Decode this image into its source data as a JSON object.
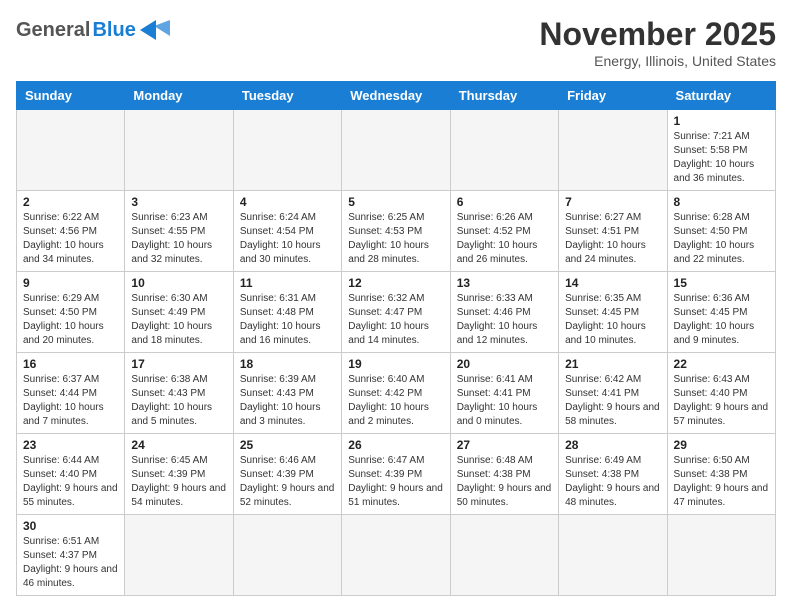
{
  "header": {
    "logo_general": "General",
    "logo_blue": "Blue",
    "month_title": "November 2025",
    "subtitle": "Energy, Illinois, United States"
  },
  "calendar": {
    "days_of_week": [
      "Sunday",
      "Monday",
      "Tuesday",
      "Wednesday",
      "Thursday",
      "Friday",
      "Saturday"
    ],
    "weeks": [
      [
        {
          "day": "",
          "info": ""
        },
        {
          "day": "",
          "info": ""
        },
        {
          "day": "",
          "info": ""
        },
        {
          "day": "",
          "info": ""
        },
        {
          "day": "",
          "info": ""
        },
        {
          "day": "",
          "info": ""
        },
        {
          "day": "1",
          "info": "Sunrise: 7:21 AM\nSunset: 5:58 PM\nDaylight: 10 hours and 36 minutes."
        }
      ],
      [
        {
          "day": "2",
          "info": "Sunrise: 6:22 AM\nSunset: 4:56 PM\nDaylight: 10 hours and 34 minutes."
        },
        {
          "day": "3",
          "info": "Sunrise: 6:23 AM\nSunset: 4:55 PM\nDaylight: 10 hours and 32 minutes."
        },
        {
          "day": "4",
          "info": "Sunrise: 6:24 AM\nSunset: 4:54 PM\nDaylight: 10 hours and 30 minutes."
        },
        {
          "day": "5",
          "info": "Sunrise: 6:25 AM\nSunset: 4:53 PM\nDaylight: 10 hours and 28 minutes."
        },
        {
          "day": "6",
          "info": "Sunrise: 6:26 AM\nSunset: 4:52 PM\nDaylight: 10 hours and 26 minutes."
        },
        {
          "day": "7",
          "info": "Sunrise: 6:27 AM\nSunset: 4:51 PM\nDaylight: 10 hours and 24 minutes."
        },
        {
          "day": "8",
          "info": "Sunrise: 6:28 AM\nSunset: 4:50 PM\nDaylight: 10 hours and 22 minutes."
        }
      ],
      [
        {
          "day": "9",
          "info": "Sunrise: 6:29 AM\nSunset: 4:50 PM\nDaylight: 10 hours and 20 minutes."
        },
        {
          "day": "10",
          "info": "Sunrise: 6:30 AM\nSunset: 4:49 PM\nDaylight: 10 hours and 18 minutes."
        },
        {
          "day": "11",
          "info": "Sunrise: 6:31 AM\nSunset: 4:48 PM\nDaylight: 10 hours and 16 minutes."
        },
        {
          "day": "12",
          "info": "Sunrise: 6:32 AM\nSunset: 4:47 PM\nDaylight: 10 hours and 14 minutes."
        },
        {
          "day": "13",
          "info": "Sunrise: 6:33 AM\nSunset: 4:46 PM\nDaylight: 10 hours and 12 minutes."
        },
        {
          "day": "14",
          "info": "Sunrise: 6:35 AM\nSunset: 4:45 PM\nDaylight: 10 hours and 10 minutes."
        },
        {
          "day": "15",
          "info": "Sunrise: 6:36 AM\nSunset: 4:45 PM\nDaylight: 10 hours and 9 minutes."
        }
      ],
      [
        {
          "day": "16",
          "info": "Sunrise: 6:37 AM\nSunset: 4:44 PM\nDaylight: 10 hours and 7 minutes."
        },
        {
          "day": "17",
          "info": "Sunrise: 6:38 AM\nSunset: 4:43 PM\nDaylight: 10 hours and 5 minutes."
        },
        {
          "day": "18",
          "info": "Sunrise: 6:39 AM\nSunset: 4:43 PM\nDaylight: 10 hours and 3 minutes."
        },
        {
          "day": "19",
          "info": "Sunrise: 6:40 AM\nSunset: 4:42 PM\nDaylight: 10 hours and 2 minutes."
        },
        {
          "day": "20",
          "info": "Sunrise: 6:41 AM\nSunset: 4:41 PM\nDaylight: 10 hours and 0 minutes."
        },
        {
          "day": "21",
          "info": "Sunrise: 6:42 AM\nSunset: 4:41 PM\nDaylight: 9 hours and 58 minutes."
        },
        {
          "day": "22",
          "info": "Sunrise: 6:43 AM\nSunset: 4:40 PM\nDaylight: 9 hours and 57 minutes."
        }
      ],
      [
        {
          "day": "23",
          "info": "Sunrise: 6:44 AM\nSunset: 4:40 PM\nDaylight: 9 hours and 55 minutes."
        },
        {
          "day": "24",
          "info": "Sunrise: 6:45 AM\nSunset: 4:39 PM\nDaylight: 9 hours and 54 minutes."
        },
        {
          "day": "25",
          "info": "Sunrise: 6:46 AM\nSunset: 4:39 PM\nDaylight: 9 hours and 52 minutes."
        },
        {
          "day": "26",
          "info": "Sunrise: 6:47 AM\nSunset: 4:39 PM\nDaylight: 9 hours and 51 minutes."
        },
        {
          "day": "27",
          "info": "Sunrise: 6:48 AM\nSunset: 4:38 PM\nDaylight: 9 hours and 50 minutes."
        },
        {
          "day": "28",
          "info": "Sunrise: 6:49 AM\nSunset: 4:38 PM\nDaylight: 9 hours and 48 minutes."
        },
        {
          "day": "29",
          "info": "Sunrise: 6:50 AM\nSunset: 4:38 PM\nDaylight: 9 hours and 47 minutes."
        }
      ],
      [
        {
          "day": "30",
          "info": "Sunrise: 6:51 AM\nSunset: 4:37 PM\nDaylight: 9 hours and 46 minutes."
        },
        {
          "day": "",
          "info": ""
        },
        {
          "day": "",
          "info": ""
        },
        {
          "day": "",
          "info": ""
        },
        {
          "day": "",
          "info": ""
        },
        {
          "day": "",
          "info": ""
        },
        {
          "day": "",
          "info": ""
        }
      ]
    ]
  }
}
